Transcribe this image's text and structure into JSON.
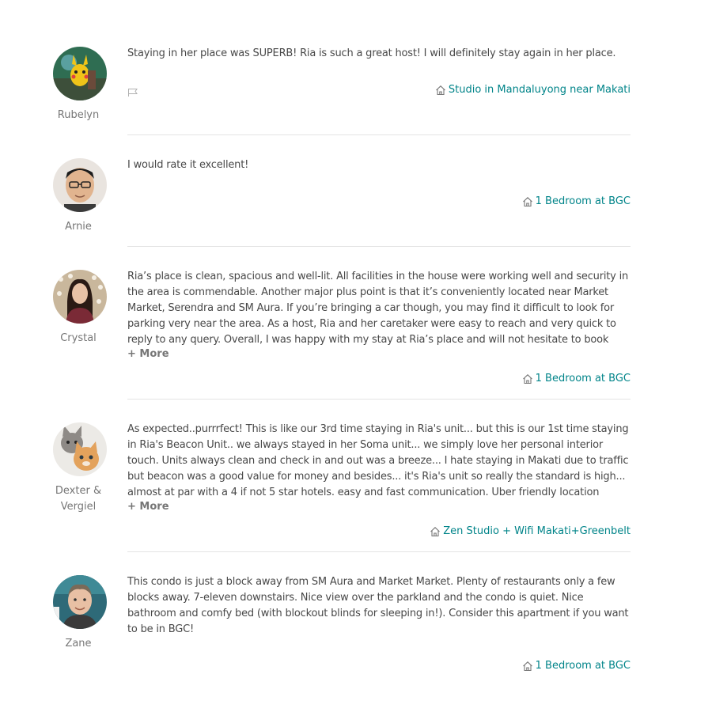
{
  "reviews": [
    {
      "name": "Rubelyn",
      "text": "Staying in her place was SUPERB! Ria is such a great host! I will definitely stay again in her place.",
      "listing": "Studio in Mandaluyong near Makati"
    },
    {
      "name": "Arnie",
      "text": "I would rate it excellent!",
      "listing": "1 Bedroom at BGC"
    },
    {
      "name": "Crystal",
      "text": "Ria’s place is clean, spacious and well-lit. All facilities in the house were working well and security in the area is commendable. Another major plus point is that it’s conveniently located near Market Market, Serendra and SM Aura. If you’re bringing a car though, you may find it difficult to look for parking very near the area. As a host, Ria and her caretaker were easy to reach and very quick to reply to any query. Overall, I was happy with my stay at Ria’s place and will not hesitate to book",
      "more": "+ More",
      "listing": "1 Bedroom at BGC"
    },
    {
      "name": "Dexter & Vergiel",
      "text": "As expected..purrrfect! This is like our 3rd time staying in Ria's unit... but this is our 1st time staying in Ria's Beacon Unit.. we always stayed in her Soma unit... we simply love her personal interior touch. Units always clean and check in and out was a breeze... I hate staying in Makati due to traffic but beacon was a good value for money and besides... it's Ria's unit so really the standard is high... almost at par with a 4 if not 5 star hotels. easy and fast communication. Uber friendly location",
      "more": "+ More",
      "listing": "Zen Studio + Wifi Makati+Greenbelt"
    },
    {
      "name": "Zane",
      "text": "This condo is just a block away from SM Aura and Market Market. Plenty of restaurants only a few blocks away. 7-eleven downstairs. Nice view over the parkland and the condo is quiet. Nice bathroom and comfy bed (with blockout blinds for sleeping in!). Consider this apartment if you want to be in BGC!",
      "listing": "1 Bedroom at BGC"
    }
  ],
  "colors": {
    "text": "#484848",
    "muted": "#767676",
    "link": "#008489",
    "divider": "#e4e4e4"
  },
  "icons": {
    "flag": "flag-icon",
    "home": "home-icon"
  }
}
